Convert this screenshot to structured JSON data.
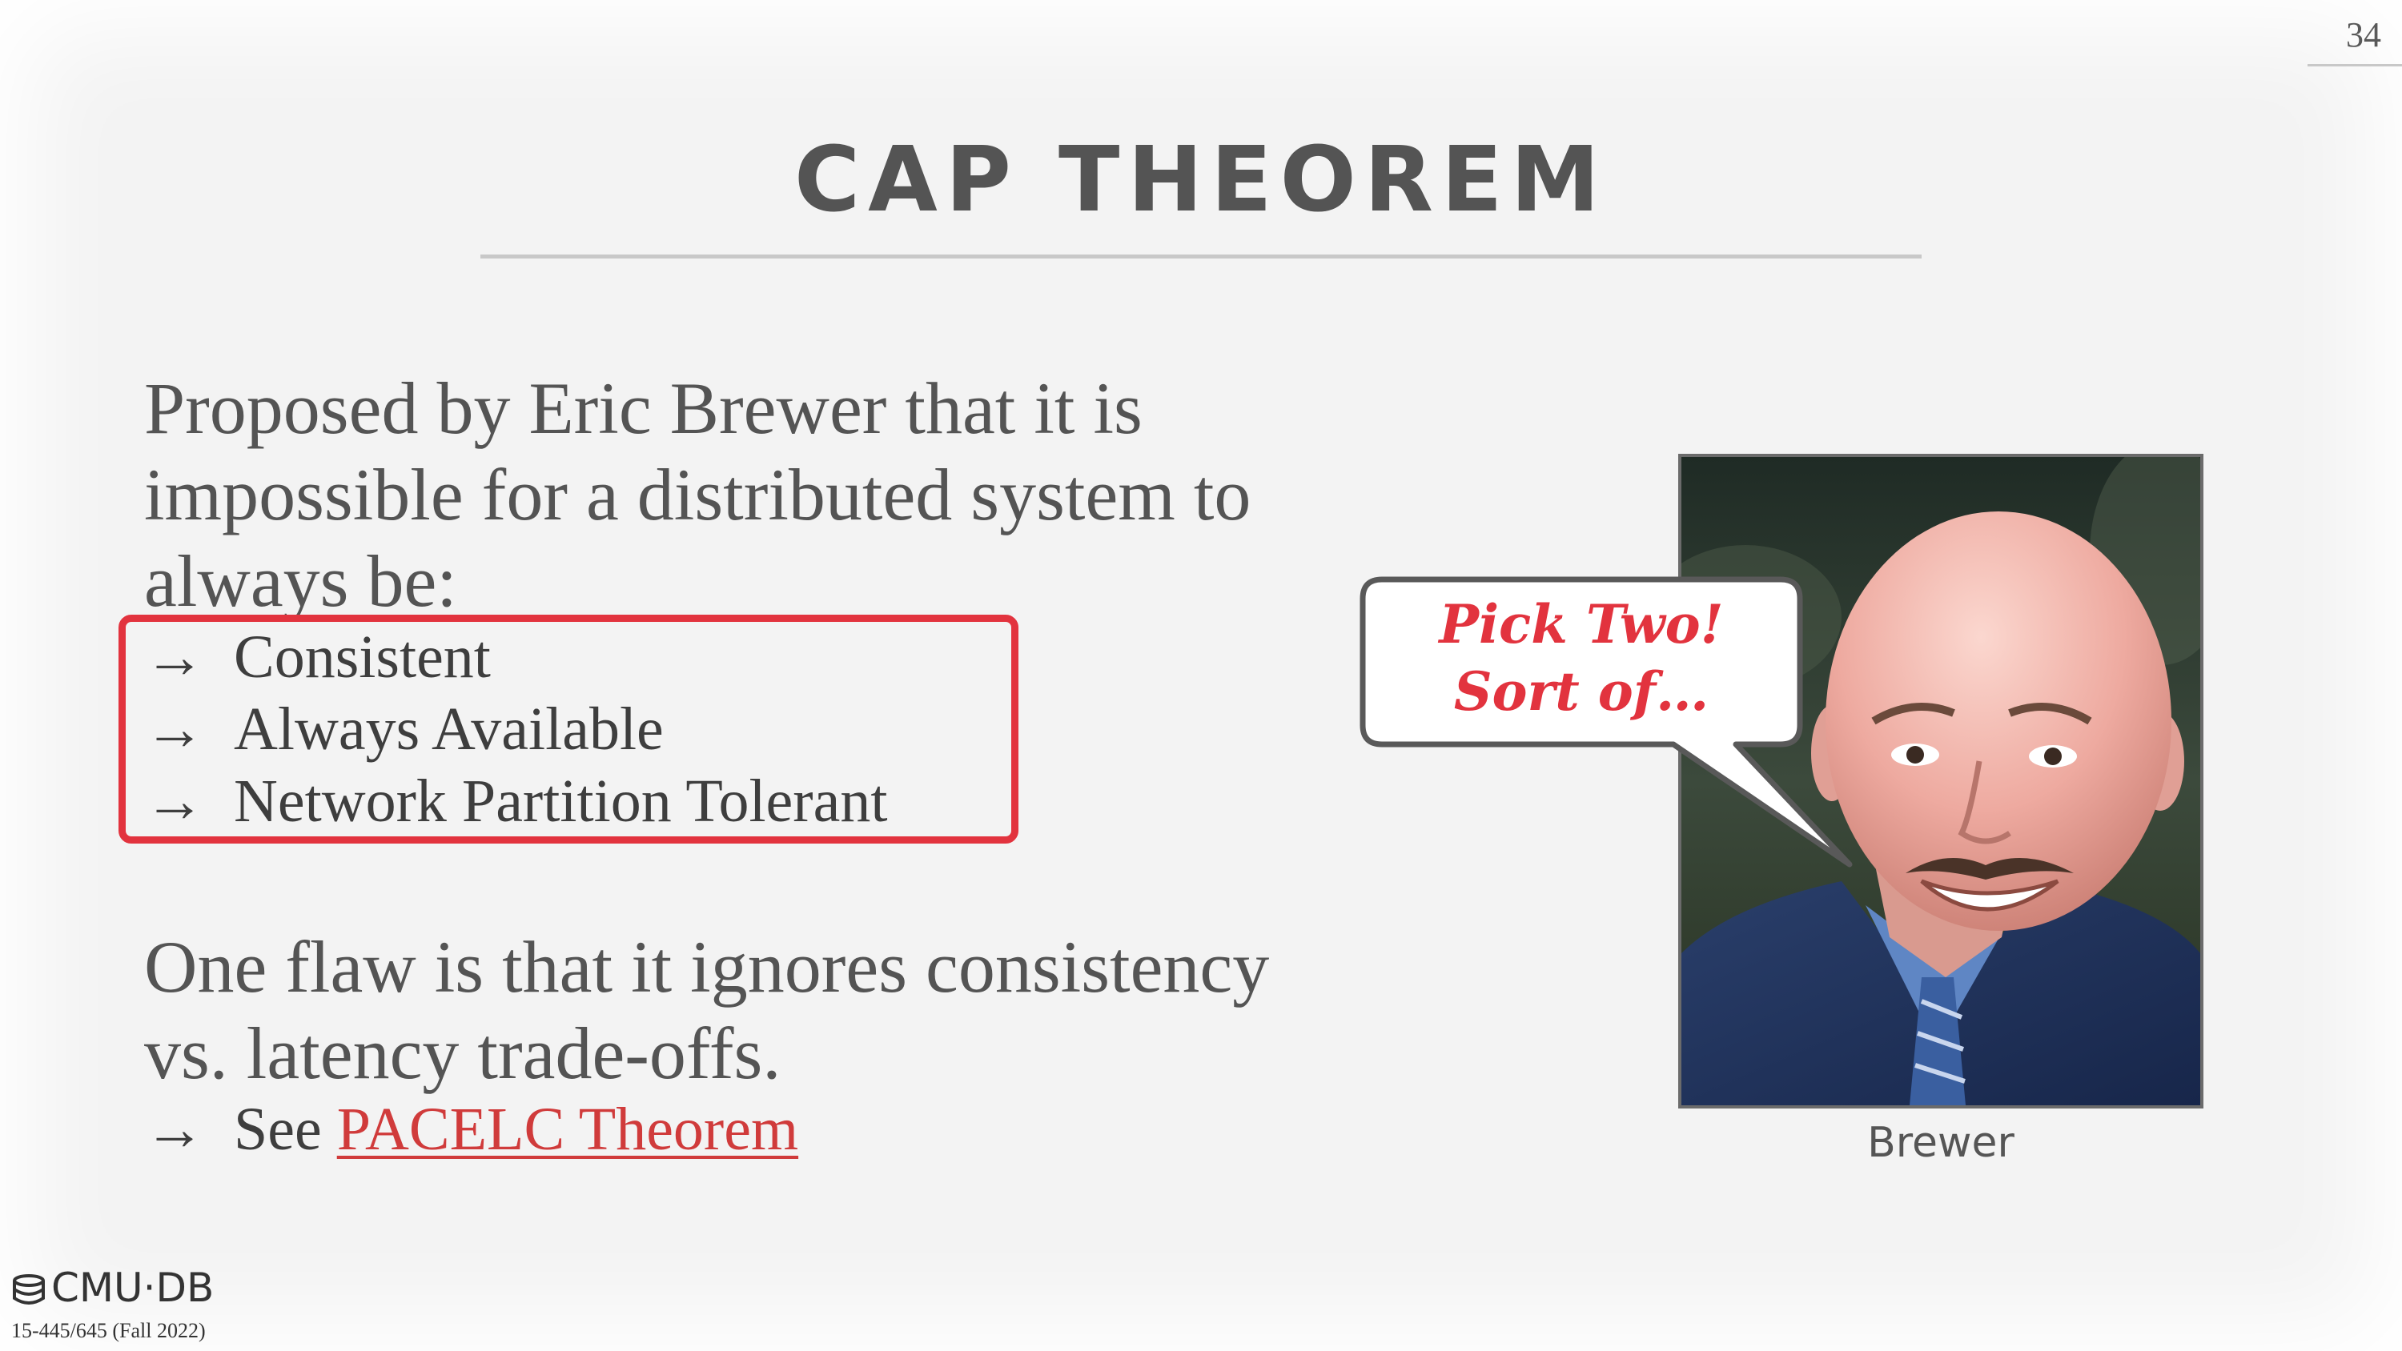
{
  "page_number": "34",
  "title": "CAP THEOREM",
  "intro_lines": [
    "Proposed by Eric Brewer that it is",
    "impossible for a distributed system to",
    "always be:"
  ],
  "properties": [
    "Consistent",
    "Always Available",
    "Network Partition Tolerant"
  ],
  "arrow": "→",
  "flaw_lines": [
    "One flaw is that it ignores consistency",
    "vs. latency trade-offs."
  ],
  "see": {
    "prefix": "See",
    "link_text": "PACELC Theorem"
  },
  "speech_bubble": {
    "line1": "Pick Two!",
    "line2": "Sort of…"
  },
  "photo_caption": "Brewer",
  "footer": {
    "logo_text": "CMU·DB",
    "course": "15-445/645 (Fall 2022)"
  },
  "colors": {
    "accent_red": "#e2333e",
    "link_red": "#d03b3b",
    "text_gray": "#545454"
  }
}
